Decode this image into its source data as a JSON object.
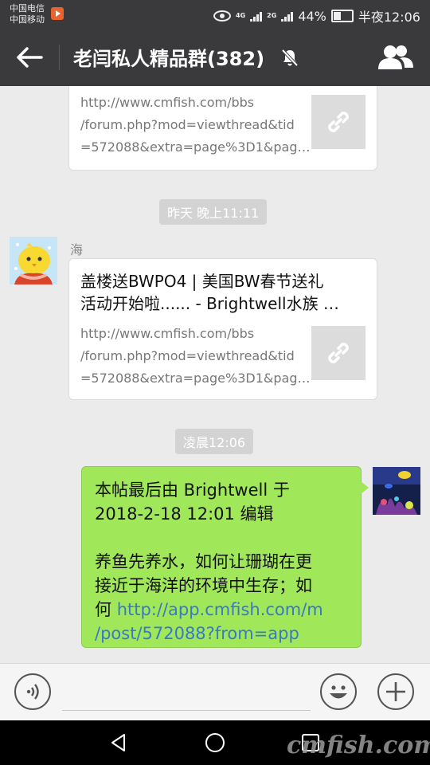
{
  "status_bar": {
    "carrier_1": "中国电信",
    "carrier_2": "中国移动",
    "net_1": "4G",
    "net_2": "2G",
    "battery_pct": "44%",
    "time": "半夜12:06"
  },
  "header": {
    "title": "老闫私人精品群(382)",
    "icons": [
      "back-arrow-icon",
      "mute-bell-icon",
      "group-members-icon"
    ]
  },
  "messages": [
    {
      "type": "link-card",
      "title": "",
      "url": "http://www.cmfish.com/bbs\n/forum.php?mod=viewthread&tid\n=572088&extra=page%3D1&pag…"
    },
    {
      "type": "time",
      "label": "昨天 晚上11:11"
    },
    {
      "type": "link-card",
      "sender": "海",
      "title": "盖楼送BWPO4 | 美国BW春节送礼\n活动开始啦...... - Brightwell水族 …",
      "url": "http://www.cmfish.com/bbs\n/forum.php?mod=viewthread&tid\n=572088&extra=page%3D1&pag…"
    },
    {
      "type": "time",
      "label": "凌晨12:06"
    },
    {
      "type": "text",
      "text": " 本帖最后由 Brightwell 于\n2018-2-18 12:01 编辑\n\n养鱼先养水，如何让珊瑚在更\n接近于海洋的环境中生存；如\n何 ",
      "link": "http://app.cmfish.com/m\n/post/572088?from=app"
    }
  ],
  "input_bar": {
    "icons": [
      "voice-icon",
      "emoji-icon",
      "plus-icon"
    ]
  },
  "nav_bar": {
    "icons": [
      "back-triangle-icon",
      "home-circle-icon",
      "recents-square-icon"
    ],
    "watermark": "cmfish.com"
  },
  "colors": {
    "bar_bg": "#3a3a3c",
    "chat_bg": "#ebebeb",
    "bubble_green": "#a0e75a",
    "link_blue": "#3a78c8"
  }
}
